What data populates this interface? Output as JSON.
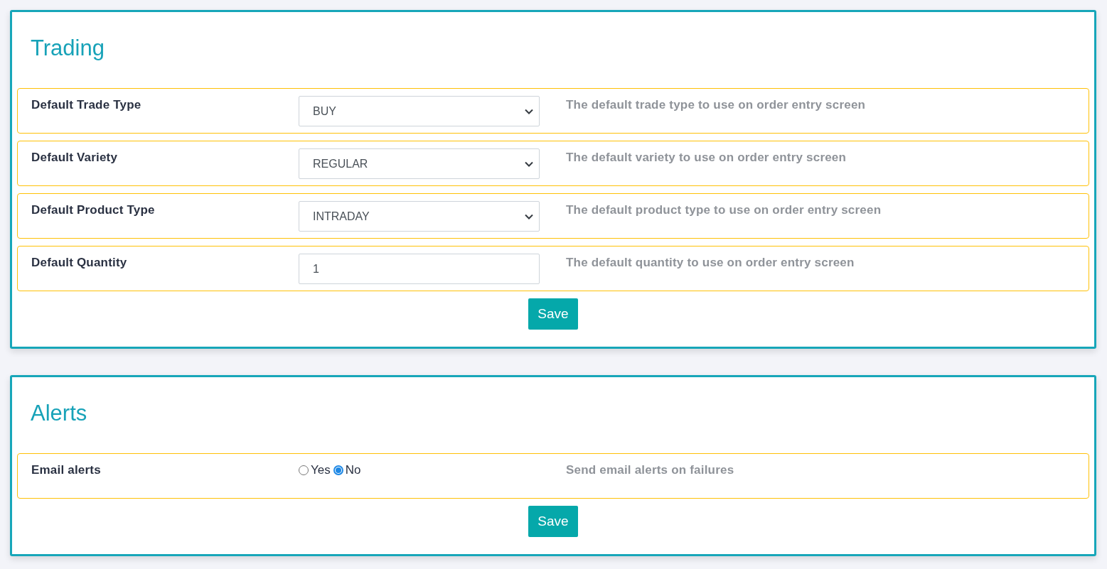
{
  "sections": [
    {
      "title": "Trading",
      "settings": [
        {
          "kind": "select",
          "label": "Default Trade Type",
          "value": "BUY",
          "description": "The default trade type to use on order entry screen"
        },
        {
          "kind": "select",
          "label": "Default Variety",
          "value": "REGULAR",
          "description": "The default variety to use on order entry screen"
        },
        {
          "kind": "select",
          "label": "Default Product Type",
          "value": "INTRADAY",
          "description": "The default product type to use on order entry screen"
        },
        {
          "kind": "input",
          "label": "Default Quantity",
          "value": "1",
          "description": "The default quantity to use on order entry screen"
        }
      ],
      "save_button": "Save"
    },
    {
      "title": "Alerts",
      "settings": [
        {
          "kind": "radio",
          "label": "Email alerts",
          "options": [
            {
              "label": "Yes",
              "selected": false
            },
            {
              "label": "No",
              "selected": true
            }
          ],
          "description": "Send email alerts on failures"
        }
      ],
      "save_button": "Save"
    }
  ]
}
